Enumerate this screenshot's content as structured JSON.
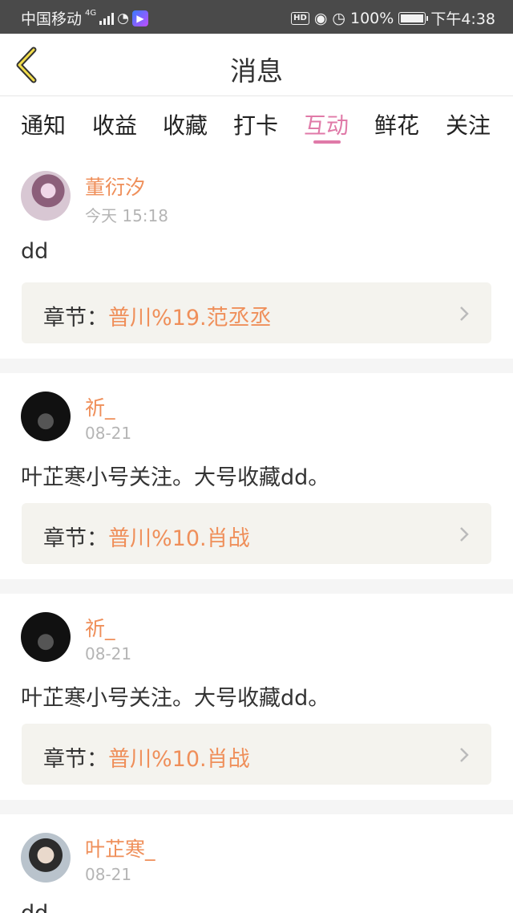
{
  "status_bar": {
    "carrier": "中国移动",
    "network": "4G",
    "battery": "100%",
    "time": "下午4:38",
    "hd": "HD",
    "app_badge": "▶"
  },
  "header": {
    "title": "消息",
    "back_icon": "chevron-left-icon"
  },
  "tabs": [
    {
      "label": "通知",
      "active": false
    },
    {
      "label": "收益",
      "active": false
    },
    {
      "label": "收藏",
      "active": false
    },
    {
      "label": "打卡",
      "active": false
    },
    {
      "label": "互动",
      "active": true
    },
    {
      "label": "鲜花",
      "active": false
    },
    {
      "label": "关注",
      "active": false
    }
  ],
  "messages": [
    {
      "user": "董衍汐",
      "time": "今天 15:18",
      "content": "dd",
      "chapter_prefix": "章节：",
      "chapter_name": "普川%19.范丞丞"
    },
    {
      "user": "祈_",
      "time": "08-21",
      "content": "叶芷寒小号关注。大号收藏dd。",
      "chapter_prefix": "章节：",
      "chapter_name": "普川%10.肖战"
    },
    {
      "user": "祈_",
      "time": "08-21",
      "content": "叶芷寒小号关注。大号收藏dd。",
      "chapter_prefix": "章节：",
      "chapter_name": "普川%10.肖战"
    },
    {
      "user": "叶芷寒_",
      "time": "08-21",
      "content": "dd"
    }
  ],
  "colors": {
    "accent_pink": "#e07aa8",
    "user_orange": "#ef8f5a",
    "status_bar_bg": "#4a4a4a"
  }
}
